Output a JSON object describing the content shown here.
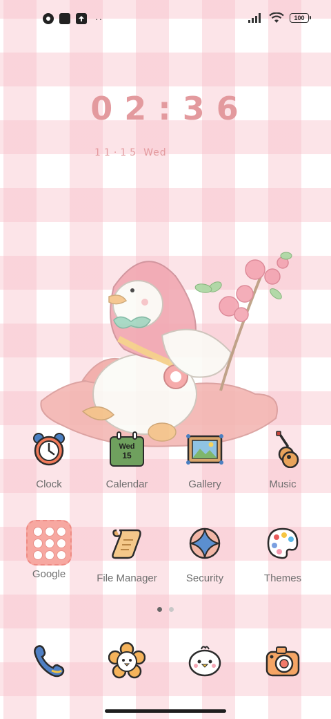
{
  "status_bar": {
    "overflow_dots": "··",
    "battery": "100",
    "left_icons": [
      "circle-app-icon",
      "square-app-icon",
      "upload-icon"
    ],
    "right_icons": [
      "signal-icon",
      "wifi-icon",
      "battery-icon"
    ]
  },
  "clock_widget": {
    "time": "02:36",
    "date": "11·15",
    "weekday": "Wed"
  },
  "apps": [
    {
      "label": "Clock",
      "icon": "alarm-clock-icon"
    },
    {
      "label": "Calendar",
      "icon": "calendar-icon",
      "icon_day": "Wed",
      "icon_date": "15"
    },
    {
      "label": "Gallery",
      "icon": "picture-frame-icon"
    },
    {
      "label": "Music",
      "icon": "guitar-icon"
    },
    {
      "label": "Google",
      "icon": "folder-icon"
    },
    {
      "label": "File Manager",
      "icon": "scroll-icon"
    },
    {
      "label": "Security",
      "icon": "shield-cross-icon"
    },
    {
      "label": "Themes",
      "icon": "palette-icon"
    }
  ],
  "dock": [
    {
      "icon": "phone-icon"
    },
    {
      "icon": "flower-face-icon"
    },
    {
      "icon": "chick-icon"
    },
    {
      "icon": "camera-icon"
    }
  ],
  "pager": {
    "pages": 2,
    "active": 1
  },
  "colors": {
    "accent": "#e39a9e",
    "check": "#f8bec8"
  }
}
